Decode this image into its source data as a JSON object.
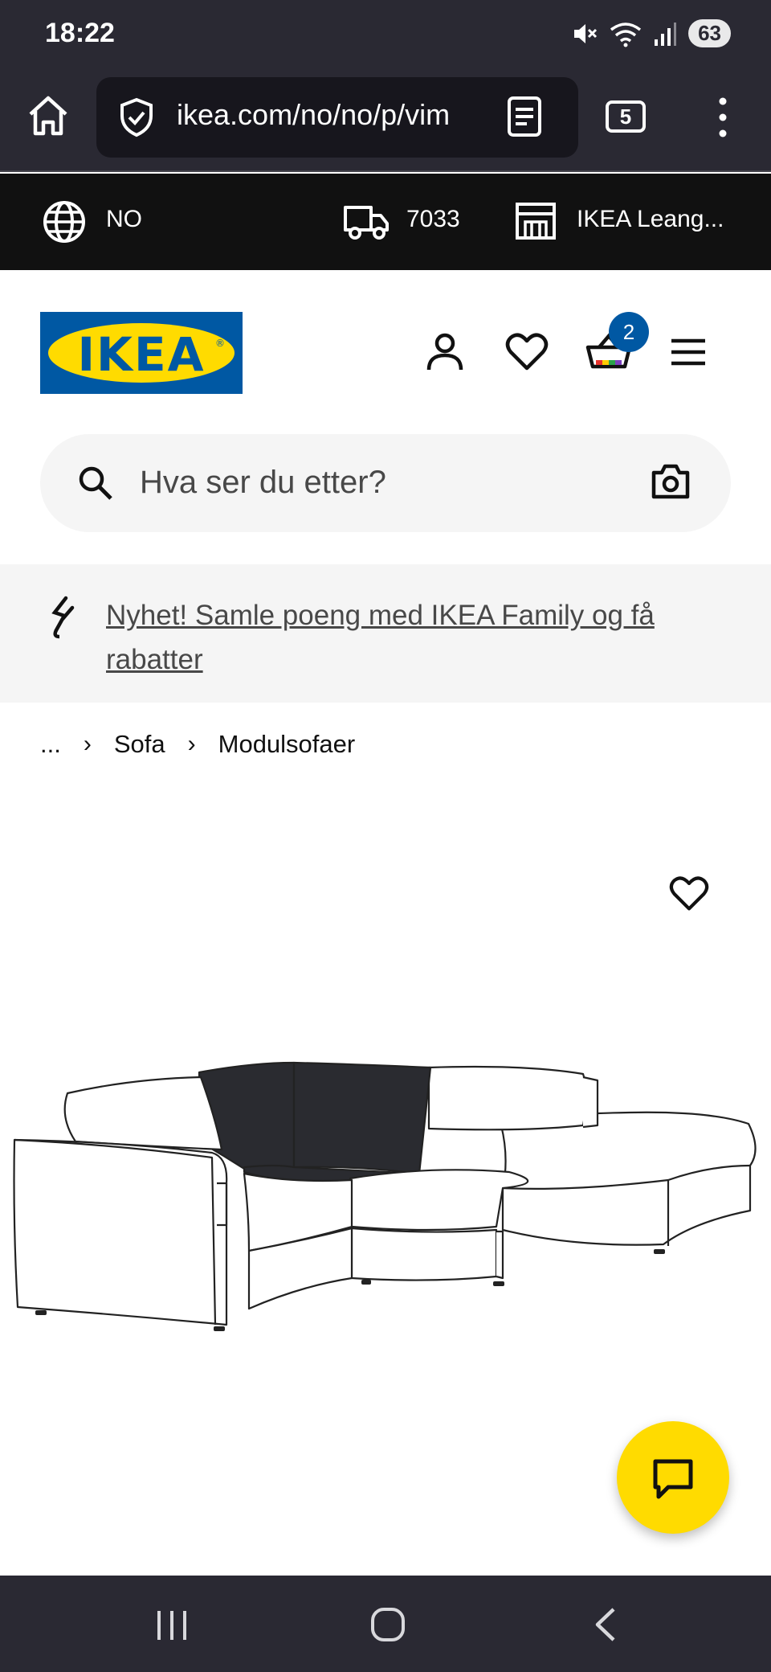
{
  "status_bar": {
    "time": "18:22",
    "battery": "63"
  },
  "browser": {
    "url_main": "ikea.com/no/no/p/vim",
    "tab_count": "5"
  },
  "top_strip": {
    "country": "NO",
    "postcode": "7033",
    "store": "IKEA Leang..."
  },
  "header": {
    "logo_text": "IKEA",
    "cart_count": "2"
  },
  "search": {
    "placeholder": "Hva ser du etter?"
  },
  "promo": {
    "text": "Nyhet! Samle poeng med IKEA Family og få rabatter"
  },
  "breadcrumb": {
    "ellipsis": "...",
    "items": [
      "Sofa",
      "Modulsofaer"
    ]
  },
  "colors": {
    "ikea_blue": "#0058a3",
    "ikea_yellow": "#ffdb00",
    "system_bar": "#2a2933"
  },
  "icons": [
    "home-icon",
    "shield-check-icon",
    "reader-mode-icon",
    "more-vert-icon",
    "globe-icon",
    "truck-icon",
    "store-icon",
    "user-icon",
    "heart-icon",
    "cart-icon",
    "menu-icon",
    "search-icon",
    "camera-icon",
    "link-icon",
    "chat-icon",
    "recents-icon",
    "home-nav-icon",
    "back-icon"
  ]
}
